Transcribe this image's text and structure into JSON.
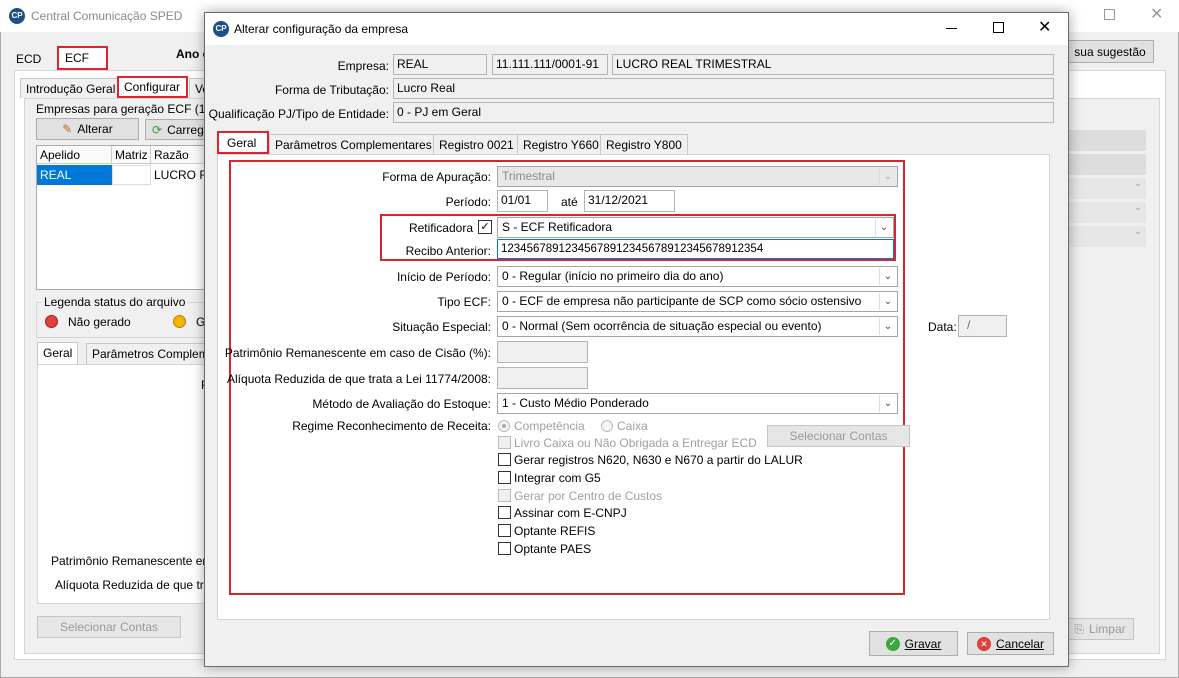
{
  "bg_window": {
    "title": "Central Comunicação SPED",
    "app_icon_text": "CP",
    "tabs_top": [
      "ECD",
      "ECF"
    ],
    "ano_label": "Ano c",
    "suggestion_button": "sua sugestão",
    "subtabs": [
      "Introdução Geral",
      "Configurar",
      "Ve"
    ],
    "group_title": "Empresas para geração ECF (1)",
    "alterar_button": "Alterar",
    "carregar_button": "Carreg",
    "grid_headers": [
      "Apelido",
      "Matriz",
      "Razão"
    ],
    "grid_row": [
      "REAL",
      "",
      "LUCRO RE"
    ],
    "legend_title": "Legenda status do arquivo",
    "legend_items": [
      "Não gerado",
      "G"
    ],
    "lower_tabs": [
      "Geral",
      "Parâmetros Complem"
    ],
    "lower_letter": "F",
    "lower_label_1": "Patrimônio Remanescente en",
    "lower_label_2": "Alíquota Reduzida de que tra",
    "selecionar_contas": "Selecionar Contas",
    "limpar": "Limpar"
  },
  "dialog": {
    "title": "Alterar configuração da empresa",
    "app_icon_text": "CP",
    "empresa_label": "Empresa:",
    "empresa_apelido": "REAL",
    "empresa_cnpj": "11.111.111/0001-91",
    "empresa_nome": "LUCRO REAL TRIMESTRAL",
    "tributacao_label": "Forma de Tributação:",
    "tributacao_value": "Lucro Real",
    "qualificacao_label": "Qualificação PJ/Tipo de Entidade:",
    "qualificacao_value": "0 - PJ em Geral",
    "tabs": [
      "Geral",
      "Parâmetros Complementares",
      "Registro 0021",
      "Registro Y660",
      "Registro Y800"
    ],
    "forma_apuracao_label": "Forma de Apuração:",
    "forma_apuracao_value": "Trimestral",
    "periodo_label": "Período:",
    "periodo_inicio": "01/01",
    "ate_label": "até",
    "periodo_fim": "31/12/2021",
    "retificadora_label": "Retificadora",
    "retificadora_checked": true,
    "retificadora_value": "S - ECF Retificadora",
    "recibo_label": "Recibo Anterior:",
    "recibo_value": "12345678912345678912345678912345678912354",
    "inicio_periodo_label": "Início de Período:",
    "inicio_periodo_value": "0 - Regular (início no primeiro dia do ano)",
    "tipo_ecf_label": "Tipo ECF:",
    "tipo_ecf_value": "0 - ECF de empresa não participante de SCP como sócio ostensivo",
    "situacao_label": "Situação Especial:",
    "situacao_value": "0 - Normal (Sem ocorrência de situação especial ou evento)",
    "data_label": "Data:",
    "data_value": "/",
    "patrimonio_label": "Patrimônio Remanescente em caso de Cisão (%):",
    "aliquota_label": "Alíquota Reduzida de que trata a Lei 11774/2008:",
    "metodo_label": "Método de Avaliação do Estoque:",
    "metodo_value": "1 - Custo Médio Ponderado",
    "regime_label": "Regime Reconhecimento de Receita:",
    "regime_options": [
      "Competência",
      "Caixa"
    ],
    "selecionar_contas": "Selecionar Contas",
    "checkboxes": [
      {
        "label": "Livro Caixa ou Não Obrigada a Entregar ECD",
        "disabled": true
      },
      {
        "label": "Gerar registros N620, N630 e N670 a partir do LALUR",
        "disabled": false
      },
      {
        "label": "Integrar com G5",
        "disabled": false
      },
      {
        "label": "Gerar por Centro de Custos",
        "disabled": true
      },
      {
        "label": "Assinar com E-CNPJ",
        "disabled": false
      },
      {
        "label": "Optante REFIS",
        "disabled": false
      },
      {
        "label": "Optante PAES",
        "disabled": false
      }
    ],
    "gravar_button": "Gravar",
    "cancelar_button": "Cancelar"
  }
}
